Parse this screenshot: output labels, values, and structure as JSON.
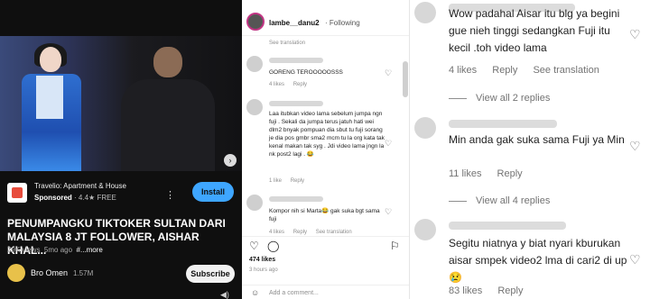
{
  "video": {
    "ad_title": "Travelio: Apartment & House",
    "ad_sponsored": "Sponsored",
    "ad_rating": "· 4.4★",
    "ad_price": "FREE",
    "ad_install": "Install",
    "title": "PENUMPANGKU TIKTOKER SULTAN DARI MALAYSIA 8 JT FOLLOWER, AISHAR KHAL...",
    "views": "29K views",
    "age": "5mo ago",
    "hashtag": "#...more",
    "channel_name": "Bro Omen",
    "channel_subs": "1.57M",
    "subscribe": "Subscribe"
  },
  "instagram": {
    "handle": "lambe__danu2",
    "following": "· Following",
    "see_translation": "See translation",
    "comments": [
      {
        "text": "GORENG TEROOOOOSSS",
        "likes": "4 likes",
        "reply": "Reply"
      },
      {
        "text": "Laa itubkan video lama sebelum jumpa ngn fuji . Sekali da jumpa terus jatuh hati wei dlm2 bnyak pompuan dia sbut tu fuji sorang je dia pos gmbr sma2 mcm tu la org kata tak kenal makan tak syg . Jdi video lama jngn la nk post2 lagi . 😂",
        "likes": "1 like",
        "reply": "Reply"
      },
      {
        "text": "Kompor nih si Marta😂 gak suka bgt sama fuji",
        "likes": "4 likes",
        "reply": "Reply",
        "translation": "See translation"
      }
    ],
    "likes_total": "474 likes",
    "time": "3 hours ago",
    "add_comment": "Add a comment..."
  },
  "zoom": {
    "comments": [
      {
        "text": "Wow padahal Aisar itu blg ya begini gue nieh tinggi sedangkan Fuji itu kecil .toh video lama",
        "likes": "4 likes",
        "reply": "Reply",
        "translation": "See translation"
      },
      {
        "view_replies": "View all 2 replies"
      },
      {
        "text": "Min anda gak suka sama Fuji ya Min",
        "likes": "11 likes",
        "reply": "Reply"
      },
      {
        "view_replies": "View all 4 replies"
      },
      {
        "text": "Segitu niatnya y biat nyari kburukan aisar smpek video2 lma di cari2 di up😢",
        "likes": "83 likes",
        "reply": "Reply"
      }
    ]
  }
}
